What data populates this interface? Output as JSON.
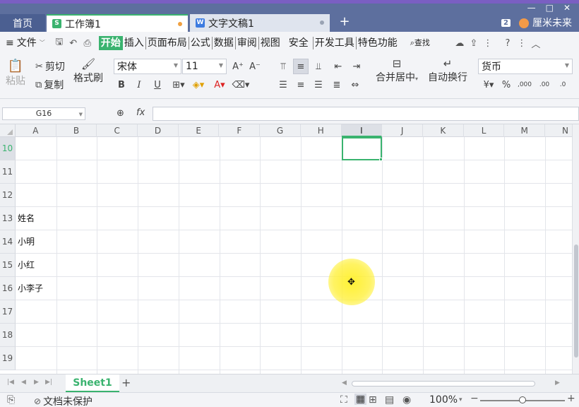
{
  "tabs": {
    "home": "首页",
    "workbook": "工作簿1",
    "workbook_icon": "S",
    "document": "文字文稿1",
    "document_icon": "W",
    "add": "+"
  },
  "window": {
    "badge": "2",
    "user": "厘米未来",
    "min": "—",
    "max": "□",
    "close": "✕"
  },
  "menu": {
    "file": "文件",
    "items": [
      "开始",
      "插入",
      "页面布局",
      "公式",
      "数据",
      "审阅",
      "视图",
      "安全",
      "开发工具",
      "特色功能"
    ],
    "active_index": 0,
    "search": "查找",
    "help": "?"
  },
  "ribbon": {
    "paste": "粘贴",
    "cut": "剪切",
    "copy": "复制",
    "format_painter": "格式刷",
    "font_name": "宋体",
    "font_size": "11",
    "bold": "B",
    "italic": "I",
    "underline": "U",
    "merge_center": "合并居中",
    "wrap_text": "自动换行",
    "number_format": "货币",
    "percent": "%"
  },
  "formula_bar": {
    "name_box": "G16",
    "fx": "fx",
    "content": ""
  },
  "grid": {
    "columns": [
      "A",
      "B",
      "C",
      "D",
      "E",
      "F",
      "G",
      "H",
      "I",
      "J",
      "K",
      "L",
      "M",
      "N"
    ],
    "selected_column": "I",
    "rows": [
      "10",
      "11",
      "12",
      "13",
      "14",
      "15",
      "16",
      "17",
      "18",
      "19"
    ],
    "selected_row": "10",
    "cells": {
      "A13": "姓名",
      "A14": "小明",
      "A15": "小红",
      "A16": "小李子"
    }
  },
  "sheets": {
    "tabs": [
      "Sheet1"
    ],
    "add": "+"
  },
  "status": {
    "protection": "文档未保护",
    "zoom": "100%"
  },
  "colors": {
    "accent": "#3ab36f",
    "titlebar": "#5d6f9e",
    "ribbon_bg": "#f3f4f7"
  }
}
